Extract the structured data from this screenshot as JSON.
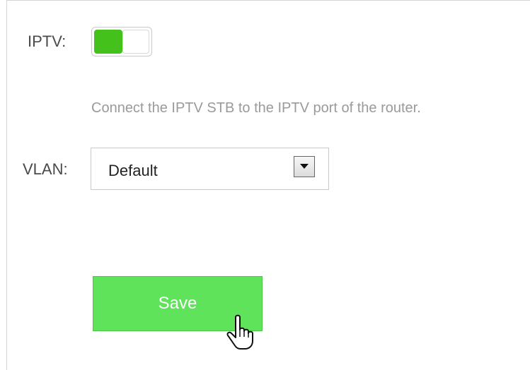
{
  "iptv": {
    "label": "IPTV:",
    "enabled": true,
    "hint": "Connect the IPTV STB to the IPTV port of the router."
  },
  "vlan": {
    "label": "VLAN:",
    "selected": "Default"
  },
  "save_label": "Save",
  "colors": {
    "toggle_on": "#44c11a",
    "save_button": "#5ee35a",
    "hint_text": "#9a9a9a"
  },
  "cursor_icon": "hand-pointer-icon"
}
